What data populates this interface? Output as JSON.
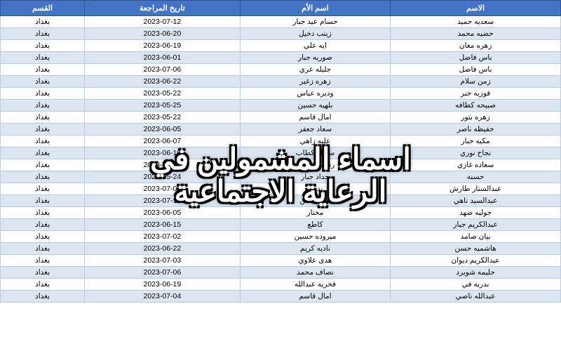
{
  "header": {
    "col1": "الاسم",
    "col2": "اسم الأم",
    "col3": "تاريخ المراجعة",
    "col4": "القسم"
  },
  "overlay": {
    "line1": "اسماء المشمولين في",
    "line2": "الرعاية الاجتماعية"
  },
  "rows": [
    {
      "name": "سعديه حميد",
      "mother": "حسام عيد جبار",
      "date": "2023-07-12",
      "dept": "بغداد"
    },
    {
      "name": "حضيه محمد",
      "mother": "زينب دخيل",
      "date": "2023-06-20",
      "dept": "بغداد"
    },
    {
      "name": "زهره معان",
      "mother": "ايه علي",
      "date": "2023-06-19",
      "dept": "بغداد"
    },
    {
      "name": "باس فاضل",
      "mother": "صوريه جبار",
      "date": "2023-06-01",
      "dept": "بغداد"
    },
    {
      "name": "باس فاضل",
      "mother": "جليله عري",
      "date": "2023-07-06",
      "dept": "بغداد"
    },
    {
      "name": "زمن سلام",
      "mother": "زهره زغير",
      "date": "2023-06-22",
      "dept": "بغداد"
    },
    {
      "name": "فوزيه جبر",
      "mother": "وديره عباس",
      "date": "2023-05-22",
      "dept": "بغداد"
    },
    {
      "name": "صبيحه كطافه",
      "mother": "بلهيه حسين",
      "date": "2023-05-25",
      "dept": "بغداد"
    },
    {
      "name": "زهره بتور",
      "mother": "امال قاسم",
      "date": "2023-05-22",
      "dept": "بغداد"
    },
    {
      "name": "حفيظه ناصر",
      "mother": "سعاد جعفر",
      "date": "2023-06-05",
      "dept": "بغداد"
    },
    {
      "name": "مكيه جبار",
      "mother": "عليه زاهي",
      "date": "2023-06-07",
      "dept": "بغداد"
    },
    {
      "name": "نجاح نوري",
      "mother": "سهيله كطاب",
      "date": "2023-06-19",
      "dept": "بغداد"
    },
    {
      "name": "سعاده غازي",
      "mother": "رسيمه محمد",
      "date": "2023-05-23",
      "dept": "بغداد"
    },
    {
      "name": "حسنه",
      "mother": "حداد جبار",
      "date": "2023-05-24",
      "dept": "بغداد"
    },
    {
      "name": "عبدالستار طارش",
      "mother": "بدري",
      "date": "2023-07-06",
      "dept": "بغداد"
    },
    {
      "name": "عبدالسيد ناهي",
      "mother": "نجه عباس",
      "date": "2023-07-13",
      "dept": "بغداد"
    },
    {
      "name": "جوليه ضهد",
      "mother": "مختار",
      "date": "2023-06-05",
      "dept": "بغداد"
    },
    {
      "name": "عبدالكريم جبار",
      "mother": "كاطع",
      "date": "2023-06-15",
      "dept": "بغداد"
    },
    {
      "name": "بيان صامد",
      "mother": "ميروده حسين",
      "date": "2023-07-02",
      "dept": "بغداد"
    },
    {
      "name": "هاشميه حسن",
      "mother": "ناديه كريم",
      "date": "2023-06-22",
      "dept": "بغداد"
    },
    {
      "name": "عبدالكريم ديوان",
      "mother": "هدى علاوي",
      "date": "2023-07-03",
      "dept": "بغداد"
    },
    {
      "name": "حليمه شويرد",
      "mother": "نصاف محمد",
      "date": "2023-07-06",
      "dept": "بغداد"
    },
    {
      "name": "بدريه في",
      "mother": "فخريه عبدالله",
      "date": "2023-06-19",
      "dept": "بغداد"
    },
    {
      "name": "عبدالله ناصي",
      "mother": "امال قاسم",
      "date": "2023-07-04",
      "dept": "بغداد"
    }
  ]
}
